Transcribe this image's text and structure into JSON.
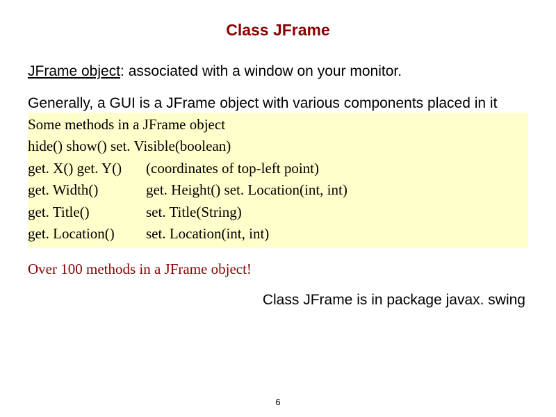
{
  "title": "Class JFrame",
  "intro": {
    "term": "JFrame object",
    "definition": ": associated with a window on your monitor."
  },
  "para2": "Generally,  a GUI is a JFrame object with various components placed in it",
  "methods": {
    "heading": "Some methods in a JFrame object",
    "row1": "hide()    show()    set. Visible(boolean)",
    "rows": [
      {
        "left": "get. X()    get. Y()",
        "right": "(coordinates of top-left point)"
      },
      {
        "left": "get. Width()",
        "right": "get. Height()        set. Location(int, int)"
      },
      {
        "left": "get. Title()",
        "right": " set. Title(String)"
      },
      {
        "left": "get. Location()",
        "right": " set. Location(int, int)"
      }
    ]
  },
  "footer_note": "Over 100 methods in a JFrame object!",
  "package_note": "Class JFrame is in package javax. swing",
  "page_number": "6"
}
